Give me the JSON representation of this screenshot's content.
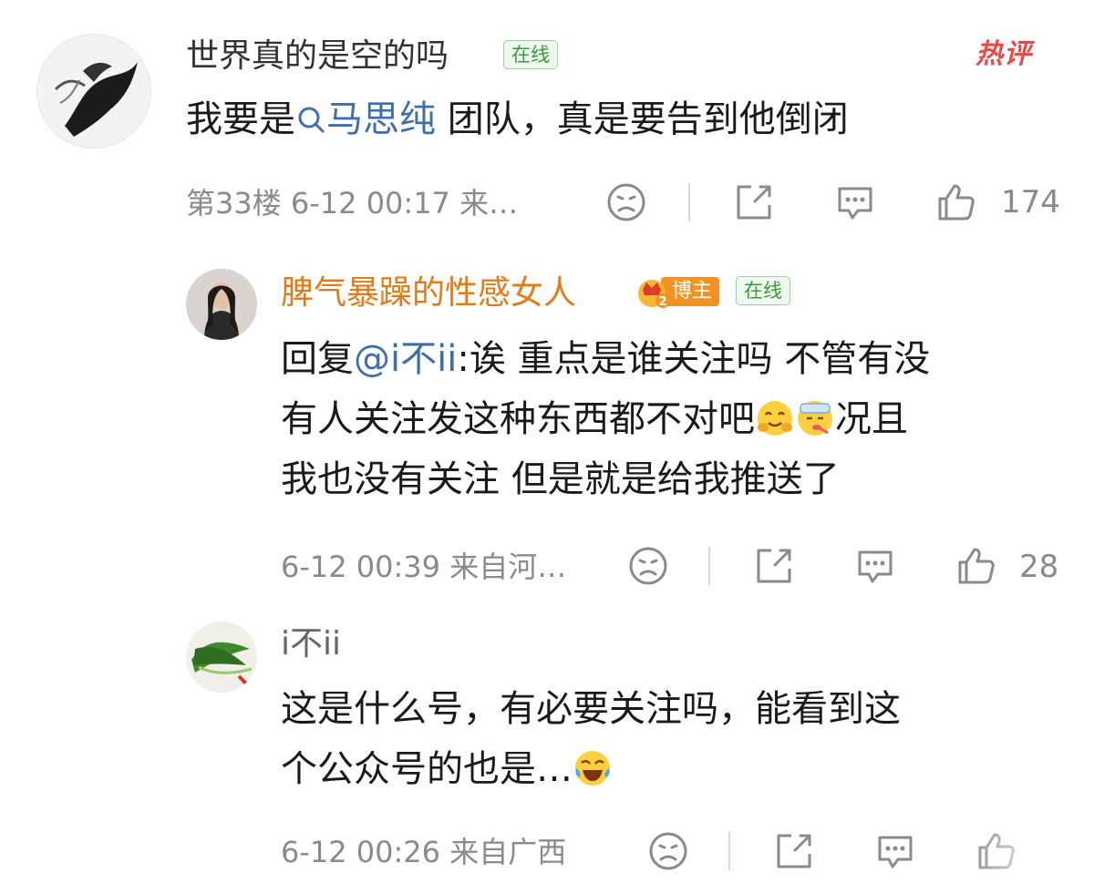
{
  "comment1": {
    "username": "世界真的是空的吗",
    "online_badge": "在线",
    "hot_label": "热评",
    "text_before": "我要是",
    "mention": "马思纯",
    "text_after": " 团队，真是要告到他倒闭",
    "meta": "第33楼 6-12 00:17 来…",
    "like_count": "174"
  },
  "reply1": {
    "username": "脾气暴躁的性感女人",
    "blogger_badge": "博主",
    "online_badge": "在线",
    "prefix": "回复",
    "mention": "@i不ii",
    "text_line1": ":诶 重点是谁关注吗 不管有没",
    "text_line2": "有人关注发这种东西都不对吧",
    "text_line2b": "况且",
    "text_line3": "我也没有关注 但是就是给我推送了",
    "meta": "6-12 00:39 来自河…",
    "like_count": "28"
  },
  "reply2": {
    "username": "i不ii",
    "text_line1": "这是什么号，有必要关注吗，能看到这",
    "text_line2": "个公众号的也是…",
    "meta": "6-12 00:26 来自广西"
  },
  "colors": {
    "mention": "#3f6ea8",
    "reply_username": "#e07b18",
    "online_badge": "#3d9a3a",
    "hot": "#e84a4a",
    "meta_gray": "#8a8a8a"
  }
}
